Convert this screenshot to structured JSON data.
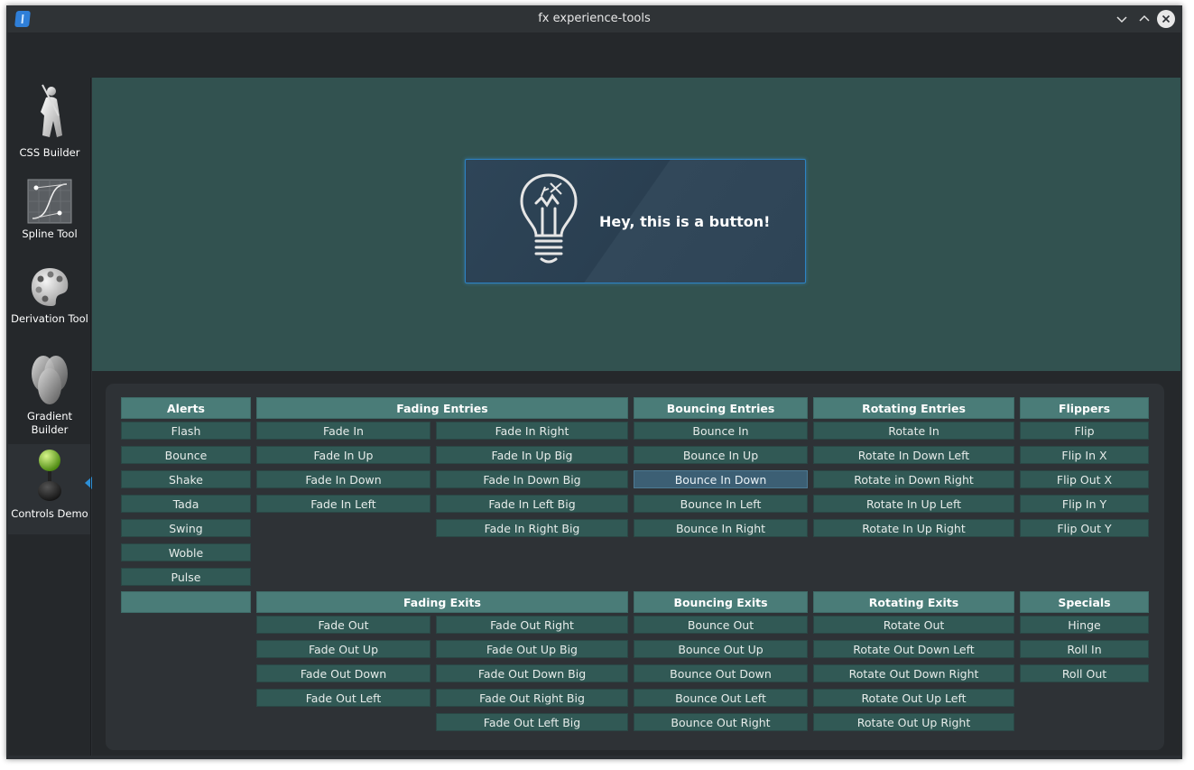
{
  "window": {
    "title": "fx experience-tools"
  },
  "sidebar": {
    "items": [
      {
        "label": "CSS Builder",
        "icon": "figure-icon"
      },
      {
        "label": "Spline Tool",
        "icon": "spline-curve-icon"
      },
      {
        "label": "Derivation Tool",
        "icon": "palette-icon"
      },
      {
        "label": "Gradient Builder",
        "icon": "gradient-eggs-icon"
      },
      {
        "label": "Controls Demo",
        "icon": "joystick-icon",
        "active": true
      }
    ]
  },
  "hero_button": {
    "label": "Hey, this is a button!",
    "icon": "lightbulb-icon"
  },
  "groups": {
    "alerts": {
      "title": "Alerts",
      "items": [
        "Flash",
        "Bounce",
        "Shake",
        "Tada",
        "Swing",
        "Woble",
        "Pulse"
      ]
    },
    "fading_entries": {
      "title": "Fading Entries",
      "col1": [
        "Fade In",
        "Fade In Up",
        "Fade In Down",
        "Fade In Left"
      ],
      "col2": [
        "Fade In Right",
        "Fade In Up Big",
        "Fade In Down Big",
        "Fade In Left Big",
        "Fade In Right Big"
      ]
    },
    "bouncing_entries": {
      "title": "Bouncing Entries",
      "items": [
        "Bounce In",
        "Bounce In Up",
        "Bounce In Down",
        "Bounce In Left",
        "Bounce In Right"
      ],
      "selected": "Bounce In Down"
    },
    "rotating_entries": {
      "title": "Rotating Entries",
      "items": [
        "Rotate In",
        "Rotate In Down Left",
        "Rotate in Down Right",
        "Rotate In Up Left",
        "Rotate In Up Right"
      ]
    },
    "flippers": {
      "title": "Flippers",
      "items": [
        "Flip",
        "Flip In X",
        "Flip Out X",
        "Flip In Y",
        "Flip Out Y"
      ]
    },
    "blank": {
      "title": ""
    },
    "fading_exits": {
      "title": "Fading Exits",
      "col1": [
        "Fade Out",
        "Fade Out Up",
        "Fade Out Down",
        "Fade Out Left"
      ],
      "col2": [
        "Fade Out Right",
        "Fade Out Up Big",
        "Fade Out Down Big",
        "Fade Out Right Big",
        "Fade Out Left Big"
      ]
    },
    "bouncing_exits": {
      "title": "Bouncing Exits",
      "items": [
        "Bounce Out",
        "Bounce Out Up",
        "Bounce Out Down",
        "Bounce Out Left",
        "Bounce Out Right"
      ]
    },
    "rotating_exits": {
      "title": "Rotating Exits",
      "items": [
        "Rotate Out",
        "Rotate Out Down Left",
        "Rotate Out Down Right",
        "Rotate Out Up Left",
        "Rotate Out Up Right"
      ]
    },
    "specials": {
      "title": "Specials",
      "items": [
        "Hinge",
        "Roll In",
        "Roll Out"
      ]
    }
  }
}
